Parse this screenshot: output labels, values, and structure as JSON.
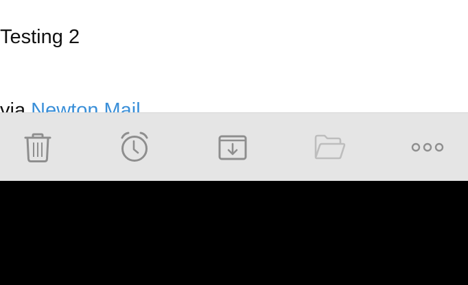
{
  "email": {
    "body_text": "Testing 2",
    "signature_prefix": "via ",
    "signature_link": "Newton Mail"
  },
  "toolbar": {
    "items": [
      {
        "icon": "trash-icon",
        "enabled": true
      },
      {
        "icon": "alarm-clock-icon",
        "enabled": true
      },
      {
        "icon": "archive-box-icon",
        "enabled": true
      },
      {
        "icon": "folder-icon",
        "enabled": false
      },
      {
        "icon": "more-icon",
        "enabled": true
      }
    ]
  },
  "colors": {
    "link": "#3a8fd8",
    "icon": "#8e8e8e",
    "icon_disabled": "#bdbdbd",
    "toolbar_bg": "#e5e5e5",
    "content_bg": "#ffffff"
  }
}
